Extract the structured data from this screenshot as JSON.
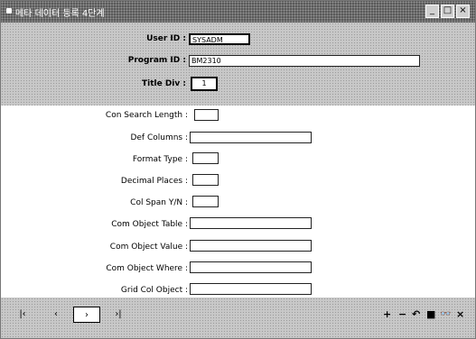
{
  "window": {
    "title": "메타 데이터 등록 4단계",
    "minimize_icon": "_",
    "maximize_icon": "□",
    "close_icon": "×"
  },
  "header": {
    "user_id_label": "User ID :",
    "user_id_value": "SYSADM",
    "program_id_label": "Program ID :",
    "program_id_value": "BM2310",
    "title_div_label": "Title Div :",
    "title_div_value": "1"
  },
  "form": {
    "fields": [
      {
        "label": "Con Search Length :",
        "value": ""
      },
      {
        "label": "Def Columns :",
        "value": ""
      },
      {
        "label": "Format Type :",
        "value": ""
      },
      {
        "label": "Decimal Places :",
        "value": ""
      },
      {
        "label": "Col Span Y/N :",
        "value": ""
      },
      {
        "label": "Com Object Table :",
        "value": ""
      },
      {
        "label": "Com Object Value :",
        "value": ""
      },
      {
        "label": "Com Object Where :",
        "value": ""
      },
      {
        "label": "Grid Col Object :",
        "value": ""
      }
    ]
  },
  "footer": {
    "nav": {
      "first": "|‹",
      "prev": "‹",
      "next": "›",
      "last": "›|"
    },
    "tools": {
      "add": "+",
      "remove": "−",
      "undo": "↶",
      "save": "■",
      "find": "👓",
      "close": "×"
    }
  }
}
